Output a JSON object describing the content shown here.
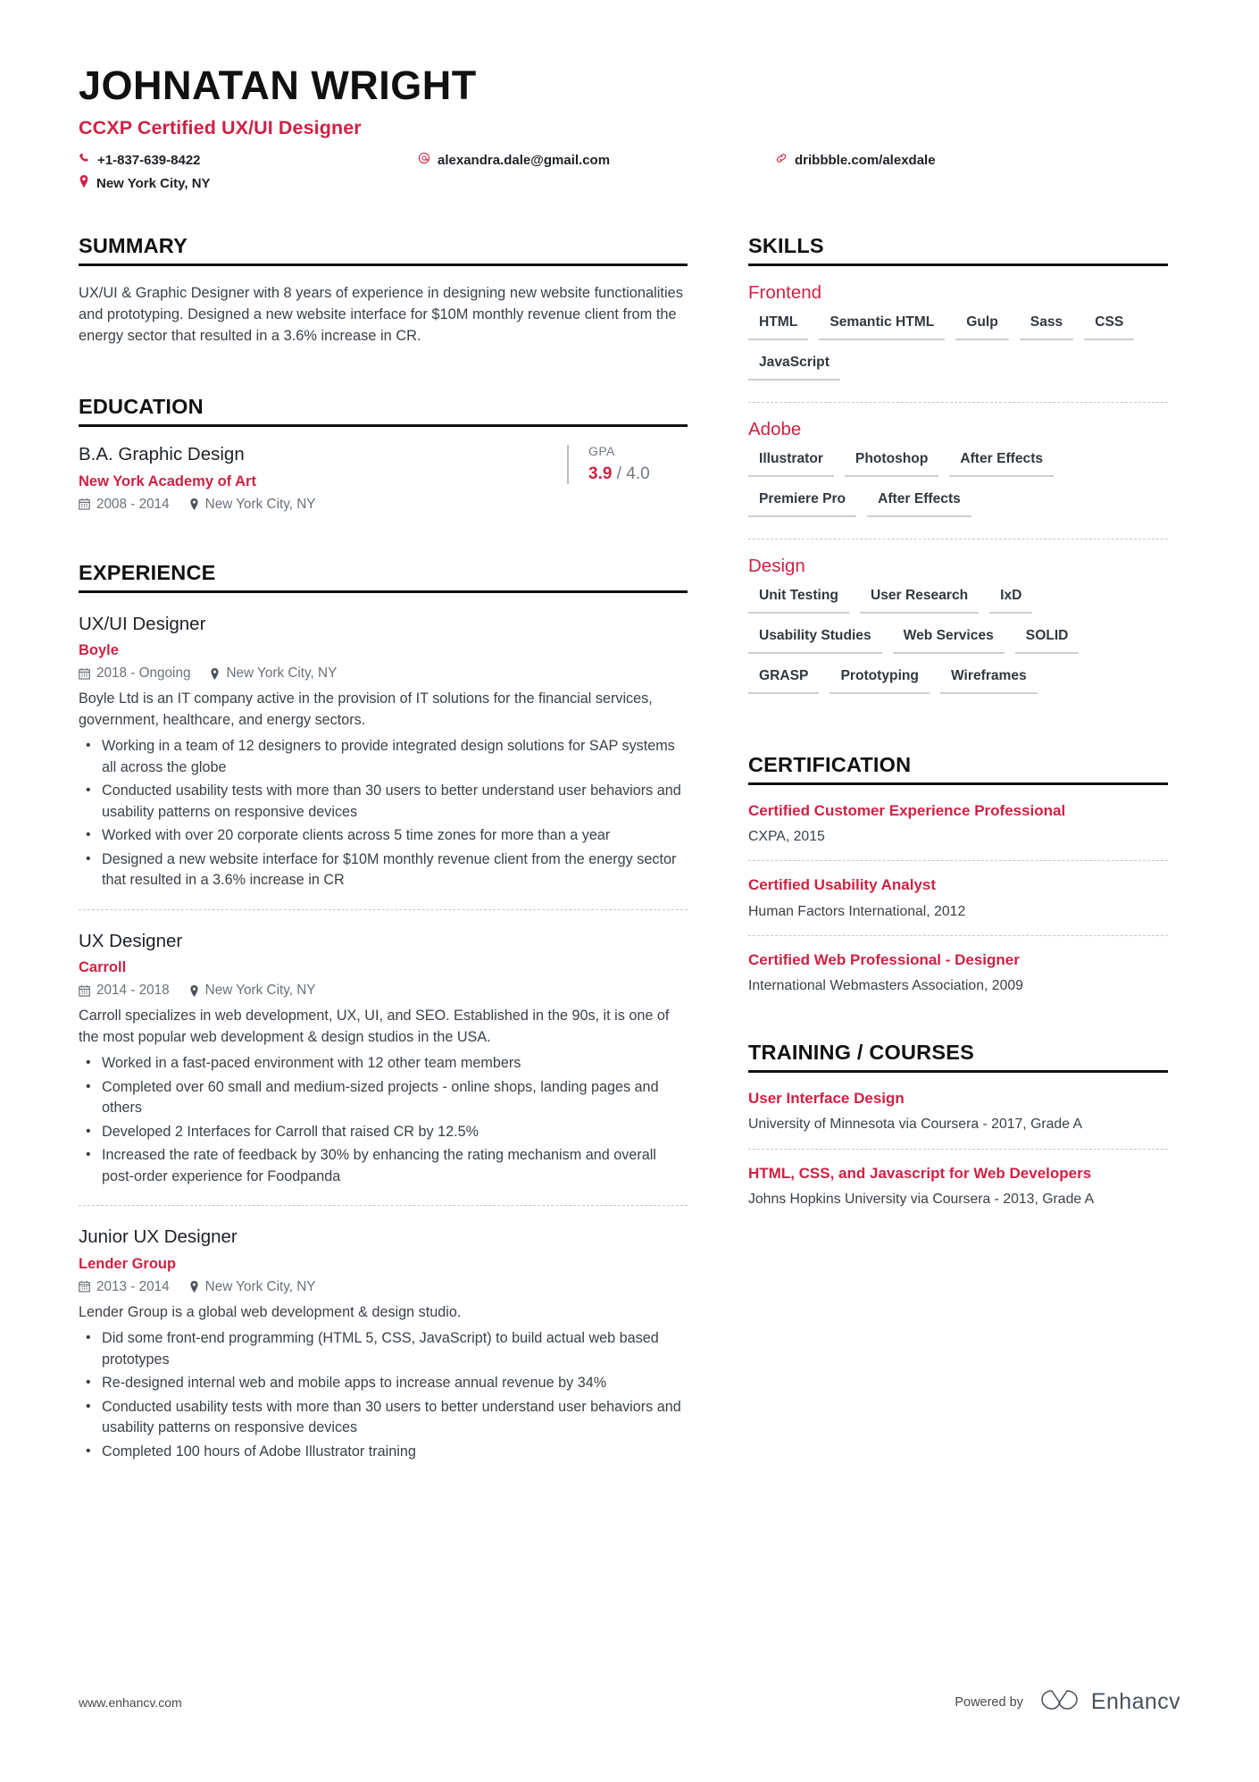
{
  "header": {
    "name": "JOHNATAN WRIGHT",
    "title": "CCXP Certified UX/UI Designer",
    "contacts": {
      "phone": "+1-837-639-8422",
      "email": "alexandra.dale@gmail.com",
      "link": "dribbble.com/alexdale",
      "location": "New York City, NY"
    }
  },
  "colors": {
    "accent_red": "#CE2244",
    "heading_black": "#111111",
    "body_gray": "#3b4149",
    "meta_gray": "#6a7179",
    "rule_gray": "#cbcfd3"
  },
  "summary": {
    "heading": "SUMMARY",
    "text": "UX/UI & Graphic Designer with 8 years of experience in designing new website functionalities and prototyping. Designed a new website interface for $10M monthly revenue client from the energy sector that resulted in a 3.6% increase in CR."
  },
  "education": {
    "heading": "EDUCATION",
    "entries": [
      {
        "degree": "B.A. Graphic Design",
        "school": "New York Academy of Art",
        "dates": "2008 - 2014",
        "location": "New York City, NY",
        "gpa_label": "GPA",
        "gpa_value": "3.9",
        "gpa_scale": "/ 4.0"
      }
    ]
  },
  "experience": {
    "heading": "EXPERIENCE",
    "jobs": [
      {
        "title": "UX/UI Designer",
        "company": "Boyle",
        "dates": "2018 - Ongoing",
        "location": "New York City, NY",
        "description": "Boyle Ltd is an IT company active in the provision of IT solutions for the financial services, government, healthcare, and energy sectors.",
        "bullets": [
          "Working in a team of 12 designers to provide integrated design solutions for SAP systems all across the globe",
          "Conducted usability tests with more than 30 users to better understand user behaviors and usability patterns on responsive devices",
          "Worked with over 20 corporate clients across 5 time zones for more than a year",
          "Designed a new website interface for $10M monthly revenue client from the energy sector that resulted in a 3.6% increase in CR"
        ]
      },
      {
        "title": "UX Designer",
        "company": "Carroll",
        "dates": "2014 - 2018",
        "location": "New York City, NY",
        "description": "Carroll specializes in web development, UX, UI, and SEO. Established in the 90s, it is one of the most popular web development & design studios in the USA.",
        "bullets": [
          "Worked in a fast-paced environment with 12 other team members",
          "Completed over 60 small and medium-sized projects - online shops, landing pages and others",
          "Developed 2 Interfaces for Carroll that raised CR by 12.5%",
          "Increased the rate of feedback by 30% by enhancing the rating mechanism and overall post-order experience for Foodpanda"
        ]
      },
      {
        "title": "Junior UX Designer",
        "company": "Lender Group",
        "dates": "2013 - 2014",
        "location": "New York City, NY",
        "description": "Lender Group is a global web development & design studio.",
        "bullets": [
          "Did some front-end programming (HTML 5, CSS, JavaScript) to build actual web based prototypes",
          "Re-designed internal web and mobile apps to increase annual revenue by 34%",
          "Conducted usability tests with more than 30 users to better understand user behaviors and usability patterns on responsive devices",
          "Completed 100 hours of Adobe Illustrator training"
        ]
      }
    ]
  },
  "skills": {
    "heading": "SKILLS",
    "groups": [
      {
        "name": "Frontend",
        "items": [
          "HTML",
          "Semantic HTML",
          "Gulp",
          "Sass",
          "CSS",
          "JavaScript"
        ]
      },
      {
        "name": "Adobe",
        "items": [
          "Illustrator",
          "Photoshop",
          "After Effects",
          "Premiere Pro",
          "After Effects"
        ]
      },
      {
        "name": "Design",
        "items": [
          "Unit Testing",
          "User Research",
          "IxD",
          "Usability Studies",
          "Web Services",
          "SOLID",
          "GRASP",
          "Prototyping",
          "Wireframes"
        ]
      }
    ]
  },
  "certification": {
    "heading": "CERTIFICATION",
    "entries": [
      {
        "title": "Certified Customer Experience Professional",
        "subtitle": "CXPA, 2015"
      },
      {
        "title": "Certified Usability Analyst",
        "subtitle": "Human Factors International, 2012"
      },
      {
        "title": "Certified Web Professional - Designer",
        "subtitle": "International Webmasters Association, 2009"
      }
    ]
  },
  "training": {
    "heading": "TRAINING / COURSES",
    "entries": [
      {
        "title": "User Interface Design",
        "subtitle": "University of Minnesota via Coursera - 2017, Grade A"
      },
      {
        "title": "HTML, CSS, and Javascript for Web Developers",
        "subtitle": "Johns Hopkins University via Coursera - 2013, Grade A"
      }
    ]
  },
  "footer": {
    "url": "www.enhancv.com",
    "powered_by": "Powered by",
    "brand": "Enhancv"
  }
}
